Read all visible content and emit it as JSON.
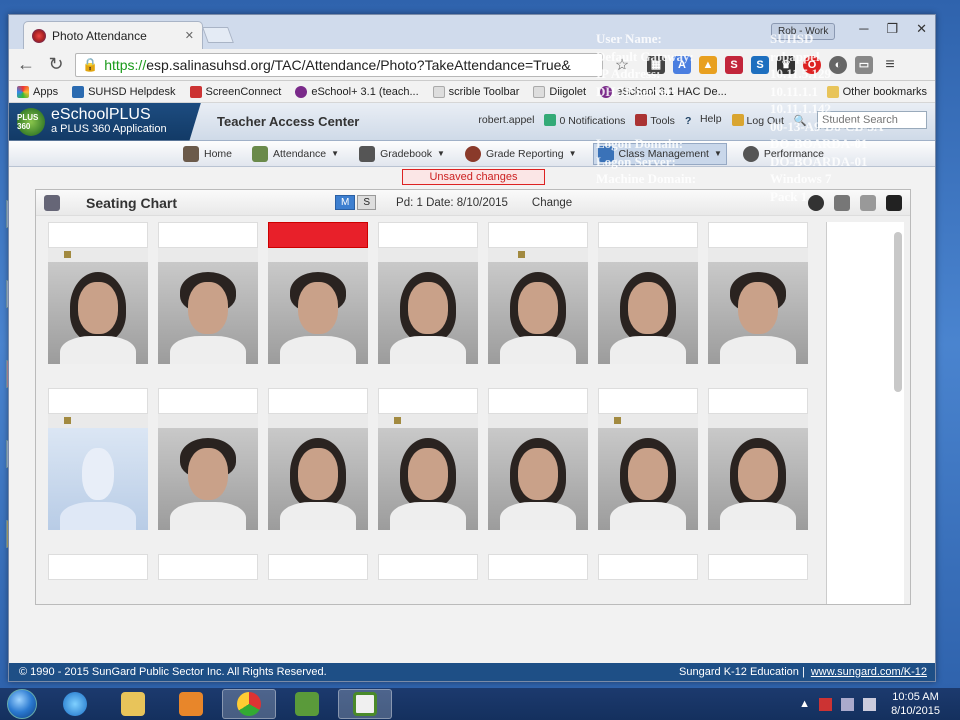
{
  "browser": {
    "tab_title": "Photo Attendance",
    "profile_label": "Rob - Work",
    "address_scheme": "https://",
    "address_rest": "esp.salinasuhsd.org/TAC/Attendance/Photo?TakeAttendance=True&",
    "bookmarks": [
      "Apps",
      "SUHSD Helpdesk",
      "ScreenConnect",
      "eSchool+ 3.1 (teach...",
      "scrible Toolbar",
      "Diigolet",
      "eSchool 3.1 HAC De..."
    ],
    "other_bookmarks": "Other bookmarks"
  },
  "bginfo": {
    "rows": [
      {
        "label": "User Name:",
        "value": "SUHSD"
      },
      {
        "label": "Default Gateway:",
        "value": "robappel"
      },
      {
        "label": "IP Address:",
        "value": "10.11.5.129"
      },
      {
        "label": "DHCP Server:",
        "value": "10.11.1.1"
      },
      {
        "label": "",
        "value": "10.11.1.142"
      },
      {
        "label": "",
        "value": "00-13-A9-D8-CB-3A"
      },
      {
        "label": "Logon Domain:",
        "value": "DO-BOARDA-01"
      },
      {
        "label": "Logon Server:",
        "value": "DO-BOARDA-01"
      },
      {
        "label": "Machine Domain:",
        "value": "Windows 7"
      },
      {
        "label": "",
        "value": "Pack 1"
      }
    ]
  },
  "app": {
    "brand_name": "eSchoolPLUS",
    "brand_sub": "a PLUS 360 Application",
    "brand_logo_text": "PLUS 360",
    "tac_title": "Teacher Access Center",
    "user_name": "robert.appel",
    "notifications": "0 Notifications",
    "tools": "Tools",
    "help": "Help",
    "logout": "Log Out",
    "student_search_placeholder": "Student Search",
    "menu": [
      {
        "label": "Home",
        "caret": false
      },
      {
        "label": "Attendance",
        "caret": true
      },
      {
        "label": "Gradebook",
        "caret": true
      },
      {
        "label": "Grade Reporting",
        "caret": true
      },
      {
        "label": "Class Management",
        "caret": true
      },
      {
        "label": "Performance",
        "caret": false
      }
    ],
    "unsaved": "Unsaved changes",
    "panel_title": "Seating Chart",
    "view_modes": [
      "M",
      "S"
    ],
    "period_date": "Pd: 1  Date: 8/10/2015",
    "change_label": "Change",
    "footer_left": "© 1990 - 2015 SunGard Public Sector Inc. All Rights Reserved.",
    "footer_right": "Sungard K-12 Education |",
    "footer_link": "www.sungard.com/K-12"
  },
  "taskbar": {
    "time": "10:05 AM",
    "date": "8/10/2015"
  },
  "colors": {
    "accent": "#1e4f86",
    "alert": "#e8202a",
    "desktop": "#3d6fb5"
  }
}
